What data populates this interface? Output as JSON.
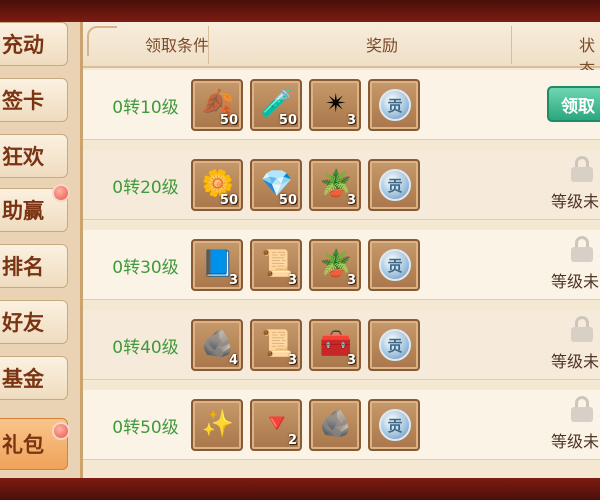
{
  "sidebar": {
    "items": [
      {
        "label": "充动",
        "active": false
      },
      {
        "label": "签卡",
        "active": false
      },
      {
        "label": "狂欢",
        "active": false
      },
      {
        "label": "助赢",
        "active": false
      },
      {
        "label": "排名",
        "active": false
      },
      {
        "label": "好友",
        "active": false
      },
      {
        "label": "基金",
        "active": false
      },
      {
        "label": "礼包",
        "active": true
      }
    ]
  },
  "header": {
    "condition": "领取条件",
    "reward": "奖励",
    "status": "状态"
  },
  "rows": [
    {
      "condition": "0转10级",
      "rewards": [
        {
          "icon": "fruit-icon",
          "glyph": "🍂",
          "count": "50"
        },
        {
          "icon": "potion-bottle-icon",
          "glyph": "🧪",
          "count": "50"
        },
        {
          "icon": "green-crystal-icon",
          "glyph": "✴",
          "count": "3"
        },
        {
          "icon": "silver-coin-icon",
          "glyph": "贡",
          "count": ""
        }
      ],
      "status": {
        "type": "claim",
        "label": "领取"
      }
    },
    {
      "condition": "0转20级",
      "rewards": [
        {
          "icon": "flower-icon",
          "glyph": "🌼",
          "count": "50"
        },
        {
          "icon": "pink-crystal-icon",
          "glyph": "💎",
          "count": "50"
        },
        {
          "icon": "potted-plant-icon",
          "glyph": "🪴",
          "count": "3"
        },
        {
          "icon": "silver-coin-icon",
          "glyph": "贡",
          "count": ""
        }
      ],
      "status": {
        "type": "locked",
        "label": "等级未"
      }
    },
    {
      "condition": "0转30级",
      "rewards": [
        {
          "icon": "blue-book-icon",
          "glyph": "📘",
          "count": "3"
        },
        {
          "icon": "scroll-icon",
          "glyph": "📜",
          "count": "3"
        },
        {
          "icon": "potted-plant-icon",
          "glyph": "🪴",
          "count": "3"
        },
        {
          "icon": "silver-coin-icon",
          "glyph": "贡",
          "count": ""
        }
      ],
      "status": {
        "type": "locked",
        "label": "等级未"
      }
    },
    {
      "condition": "0转40级",
      "rewards": [
        {
          "icon": "dark-ore-icon",
          "glyph": "🪨",
          "count": "4"
        },
        {
          "icon": "scroll-icon",
          "glyph": "📜",
          "count": "3"
        },
        {
          "icon": "treasure-chest-icon",
          "glyph": "🧰",
          "count": "3"
        },
        {
          "icon": "silver-coin-icon",
          "glyph": "贡",
          "count": ""
        }
      ],
      "status": {
        "type": "locked",
        "label": "等级未"
      }
    },
    {
      "condition": "0转50级",
      "rewards": [
        {
          "icon": "gold-star-shard-icon",
          "glyph": "✨",
          "count": ""
        },
        {
          "icon": "red-gem-icon",
          "glyph": "🔻",
          "count": "2"
        },
        {
          "icon": "dark-ore-icon",
          "glyph": "🪨",
          "count": ""
        },
        {
          "icon": "silver-coin-icon",
          "glyph": "贡",
          "count": ""
        }
      ],
      "status": {
        "type": "locked",
        "label": "等级未"
      }
    }
  ]
}
